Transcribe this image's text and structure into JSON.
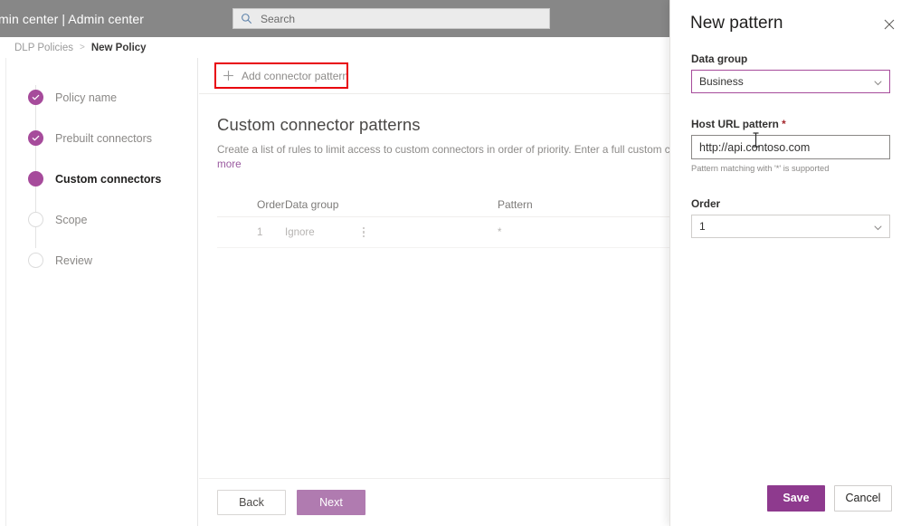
{
  "suite": {
    "title": "min center  |  Admin center",
    "search_placeholder": "Search",
    "search_icon": "search-icon"
  },
  "breadcrumb": {
    "parent": "DLP Policies",
    "separator": ">",
    "current": "New Policy"
  },
  "stepper": {
    "steps": [
      {
        "label": "Policy name",
        "state": "done"
      },
      {
        "label": "Prebuilt connectors",
        "state": "done"
      },
      {
        "label": "Custom connectors",
        "state": "current"
      },
      {
        "label": "Scope",
        "state": "todo"
      },
      {
        "label": "Review",
        "state": "todo"
      }
    ]
  },
  "command_bar": {
    "add_pattern_label": "Add connector pattern",
    "add_pattern_icon": "plus-icon",
    "highlight_color": "#e8000d"
  },
  "main": {
    "section_title": "Custom connector patterns",
    "description_line1": "Create a list of rules to limit access to custom connectors in order of priority. Enter a full custom connector U",
    "description_line2": "more",
    "more_link": "more"
  },
  "table": {
    "columns": [
      "Order",
      "Data group",
      "Pattern"
    ],
    "rows": [
      {
        "order": "1",
        "data_group": "Ignore",
        "pattern": "*",
        "menu_icon": "more-vertical-icon"
      }
    ]
  },
  "wizard_footer": {
    "back_label": "Back",
    "next_label": "Next",
    "next_color": "#b07bb0"
  },
  "panel": {
    "title": "New pattern",
    "close_icon": "close-icon",
    "data_group": {
      "label": "Data group",
      "value": "Business",
      "chevron_icon": "chevron-down-icon"
    },
    "host_url": {
      "label": "Host URL pattern",
      "required_marker": "*",
      "value": "http://api.contoso.com",
      "placeholder": "http://api.contoso.com",
      "hint": "Pattern matching with '*' is supported"
    },
    "order": {
      "label": "Order",
      "value": "1",
      "chevron_icon": "chevron-down-icon"
    },
    "save_label": "Save",
    "cancel_label": "Cancel",
    "save_color": "#8e3a8e",
    "accent_color": "#a64b9b"
  }
}
